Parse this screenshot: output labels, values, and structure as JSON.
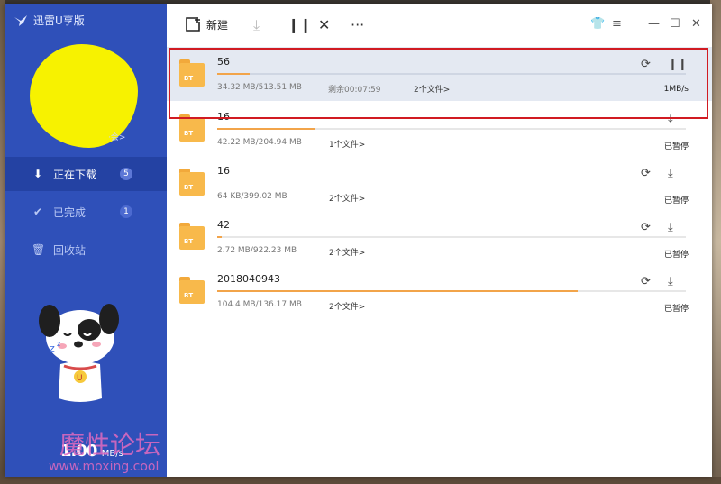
{
  "app": {
    "title": "迅雷U享版"
  },
  "sidebar": {
    "avatar_text": "·会>",
    "nav": [
      {
        "label": "正在下载",
        "badge": "5",
        "icon": "download-arrow-icon"
      },
      {
        "label": "已完成",
        "badge": "1",
        "icon": "checkmark-icon"
      },
      {
        "label": "回收站",
        "badge": "",
        "icon": "trash-icon"
      }
    ],
    "speed_value": "1.00",
    "speed_unit": "MB/s"
  },
  "toolbar": {
    "new_label": "新建"
  },
  "downloads": [
    {
      "name": "56",
      "size": "34.32 MB/513.51 MB",
      "remaining": "剩余00:07:59",
      "files": "2个文件>",
      "status": "1MB/s",
      "progress": 0.067,
      "selected": true
    },
    {
      "name": "16",
      "size": "42.22 MB/204.94 MB",
      "remaining": "",
      "files": "1个文件>",
      "status": "已暂停",
      "progress": 0.206,
      "selected": false
    },
    {
      "name": "16",
      "size": "64 KB/399.02 MB",
      "remaining": "",
      "files": "2个文件>",
      "status": "已暂停",
      "progress": 0.0,
      "selected": false
    },
    {
      "name": "42",
      "size": "2.72 MB/922.23 MB",
      "remaining": "",
      "files": "2个文件>",
      "status": "已暂停",
      "progress": 0.003,
      "selected": false
    },
    {
      "name": "2018040943",
      "size": "104.4 MB/136.17 MB",
      "remaining": "",
      "files": "2个文件>",
      "status": "已暂停",
      "progress": 0.767,
      "selected": false
    }
  ],
  "folder_badge": "BT",
  "watermark": {
    "main": "魔性论坛",
    "sub": "www.moxing.cool"
  },
  "colors": {
    "sidebar": "#2f50b9",
    "progress": "#f2a44a",
    "highlight": "#d11b22",
    "avatar_scribble": "#f7f200"
  }
}
